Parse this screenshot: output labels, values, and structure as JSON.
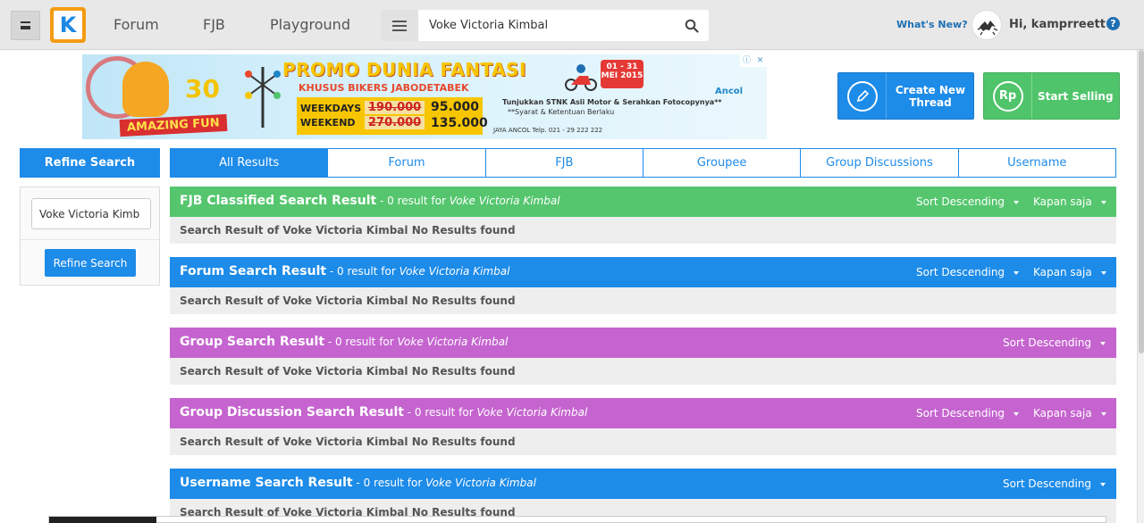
{
  "nav": {
    "logo_letter": "K",
    "links": [
      "Forum",
      "FJB",
      "Playground"
    ],
    "search_value": "Voke Victoria Kimbal",
    "whats_new": "What's New?",
    "greeting": "Hi, kamprreett",
    "help": "?"
  },
  "banner": {
    "promo": "PROMO DUNIA FANTASI",
    "khusus": "KHUSUS BIKERS JABODETABEK",
    "thirty": "30",
    "amazing": "AMAZING FUN",
    "weekdays": "WEEKDAYS",
    "weekend": "WEEKEND",
    "old_weekdays": "190.000",
    "old_weekend": "270.000",
    "new_weekdays": "95.000",
    "new_weekend": "135.000",
    "dates": "01 - 31 MEI 2015",
    "note": "Tunjukkan STNK Asli Motor & Serahkan Fotocopynya**",
    "note2": "**Syarat & Ketentuan Berlaku",
    "footer": "JAYA ANCOL    Telp. 021 - 29 222 222",
    "ancol": "Ancol"
  },
  "actions": {
    "create_thread": "Create New Thread",
    "start_selling": "Start Selling",
    "rp": "Rp"
  },
  "refine": {
    "title": "Refine Search",
    "input_value": "Voke Victoria Kimb",
    "button": "Refine Search"
  },
  "tabs": [
    "All Results",
    "Forum",
    "FJB",
    "Groupee",
    "Group Discussions",
    "Username"
  ],
  "sections": [
    {
      "title": "FJB Classified Search Result",
      "meta": " - 0 result for ",
      "query": "Voke Victoria Kimbal",
      "sort": "Sort Descending",
      "time": "Kapan saja",
      "body": "Search Result of Voke Victoria Kimbal No Results found"
    },
    {
      "title": "Forum Search Result",
      "meta": " - 0 result for ",
      "query": "Voke Victoria Kimbal",
      "sort": "Sort Descending",
      "time": "Kapan saja",
      "body": "Search Result of Voke Victoria Kimbal No Results found"
    },
    {
      "title": "Group Search Result",
      "meta": " - 0 result for ",
      "query": "Voke Victoria Kimbal",
      "sort": "Sort Descending",
      "time": "",
      "body": "Search Result of Voke Victoria Kimbal No Results found"
    },
    {
      "title": "Group Discussion Search Result",
      "meta": " - 0 result for ",
      "query": "Voke Victoria Kimbal",
      "sort": "Sort Descending",
      "time": "Kapan saja",
      "body": "Search Result of Voke Victoria Kimbal No Results found"
    },
    {
      "title": "Username Search Result",
      "meta": " - 0 result for ",
      "query": "Voke Victoria Kimbal",
      "sort": "Sort Descending",
      "time": "",
      "body": "Search Result of Voke Victoria Kimbal No Results found"
    }
  ],
  "colors": {
    "blue": "#1d8be8",
    "green": "#55c66e",
    "purple": "#c564cf",
    "orange": "#f39c12"
  }
}
